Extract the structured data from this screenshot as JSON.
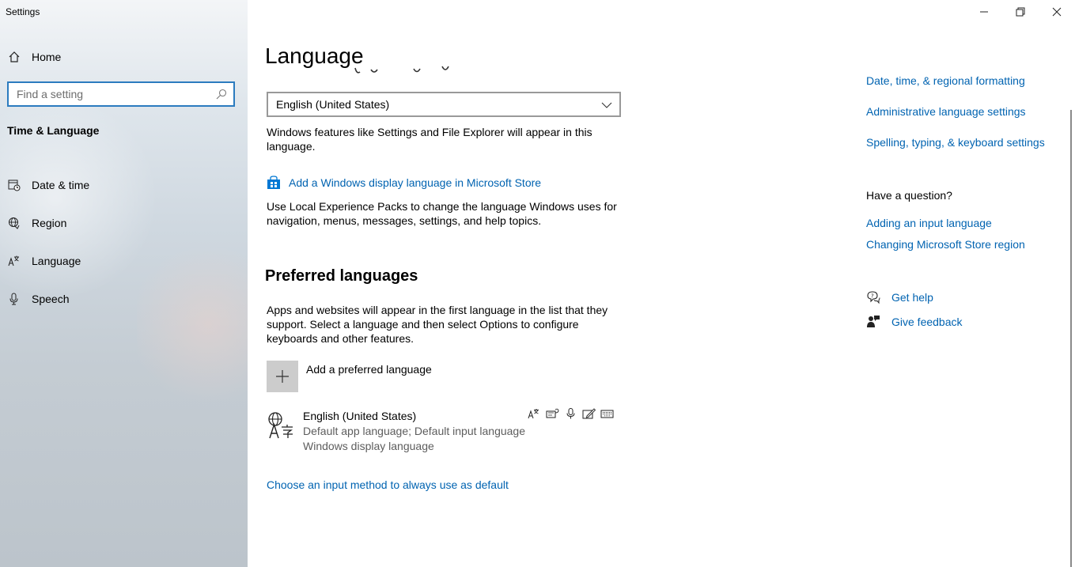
{
  "window": {
    "title": "Settings"
  },
  "sidebar": {
    "home_label": "Home",
    "search_placeholder": "Find a setting",
    "section_title": "Time & Language",
    "items": [
      {
        "label": "Date & time",
        "icon": "date-time-icon"
      },
      {
        "label": "Region",
        "icon": "globe-icon"
      },
      {
        "label": "Language",
        "icon": "language-icon"
      },
      {
        "label": "Speech",
        "icon": "microphone-icon"
      }
    ]
  },
  "main": {
    "title": "Language",
    "display_language": {
      "selected": "English (United States)",
      "description": "Windows features like Settings and File Explorer will appear in this language.",
      "store_link": "Add a Windows display language in Microsoft Store",
      "store_description": "Use Local Experience Packs to change the language Windows uses for navigation, menus, messages, settings, and help topics."
    },
    "preferred": {
      "heading": "Preferred languages",
      "description": "Apps and websites will appear in the first language in the list that they support. Select a language and then select Options to configure keyboards and other features.",
      "add_label": "Add a preferred language",
      "languages": [
        {
          "name": "English (United States)",
          "line1": "Default app language; Default input language",
          "line2": "Windows display language",
          "feature_icons": [
            "display-language-icon",
            "text-to-speech-icon",
            "speech-recognition-icon",
            "handwriting-icon",
            "keyboard-icon"
          ]
        }
      ]
    },
    "default_input_link": "Choose an input method to always use as default"
  },
  "related": {
    "links": [
      "Date, time, & regional formatting",
      "Administrative language settings",
      "Spelling, typing, & keyboard settings"
    ],
    "question_heading": "Have a question?",
    "question_links": [
      "Adding an input language",
      "Changing Microsoft Store region"
    ],
    "get_help": "Get help",
    "give_feedback": "Give feedback"
  },
  "colors": {
    "accent": "#0063b1",
    "focus_border": "#2b7bbf"
  }
}
